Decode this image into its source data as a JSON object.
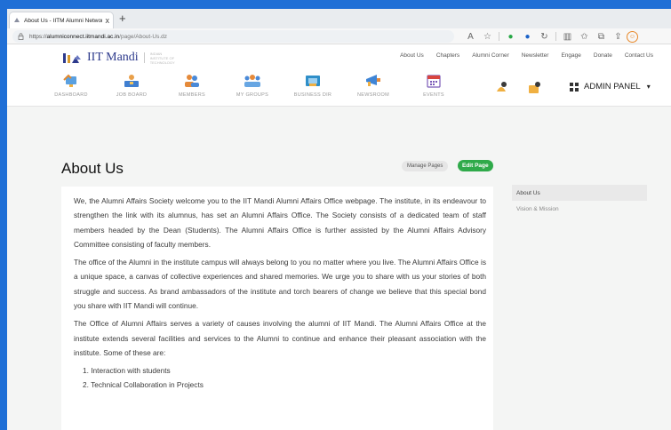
{
  "browser": {
    "tab_title": "About Us - IITM Alumni Network",
    "tab_close": "x",
    "new_tab": "+",
    "url_scheme": "https://",
    "url_host": "alumniconnect.iitmandi.ac.in",
    "url_path": "/page/About-Us.dz",
    "icons": [
      "read-aloud-icon",
      "favorite-icon",
      "extension-green-icon",
      "extension-blue-icon",
      "refresh-icon",
      "split-screen-icon",
      "favorites-icon",
      "collections-icon",
      "share-icon",
      "profile-icon"
    ]
  },
  "site": {
    "brand": "IIT Mandi",
    "tagline": "INDIAN INSTITUTE OF TECHNOLOGY",
    "top_nav": [
      "About Us",
      "Chapters",
      "Alumni Corner",
      "Newsletter",
      "Engage",
      "Donate",
      "Contact Us"
    ],
    "icon_nav": [
      {
        "label": "DASHBOARD",
        "icon": "dashboard-icon"
      },
      {
        "label": "JOB BOARD",
        "icon": "job-board-icon"
      },
      {
        "label": "MEMBERS",
        "icon": "members-icon"
      },
      {
        "label": "MY GROUPS",
        "icon": "groups-icon"
      },
      {
        "label": "BUSINESS DIR",
        "icon": "business-dir-icon"
      },
      {
        "label": "NEWSROOM",
        "icon": "newsroom-icon"
      },
      {
        "label": "EVENTS",
        "icon": "events-icon"
      }
    ],
    "admin_panel": "ADMIN PANEL",
    "admin_caret": "▾"
  },
  "main": {
    "title": "About Us",
    "manage_pages": "Manage Pages",
    "edit_page": "Edit Page",
    "paragraphs": [
      "We, the Alumni Affairs Society welcome you to the IIT Mandi Alumni Affairs Office webpage. The institute, in its endeavour to strengthen the link with its alumnus, has set an Alumni Affairs Office. The Society consists of a dedicated team of staff members headed by the Dean (Students). The Alumni Affairs Office is further assisted by the Alumni Affairs Advisory Committee consisting of faculty members.",
      "The office of the Alumni in the institute campus will always belong to you no matter where you live. The Alumni Affairs Office is a unique space, a canvas of collective experiences and shared memories. We urge you to share with us your stories of both struggle and success. As brand ambassadors of the institute and torch bearers of change we believe that this special bond you share with IIT Mandi will continue.",
      "The Office of Alumni Affairs serves a variety of causes involving the alumni of IIT Mandi. The Alumni Affairs Office at the institute extends several facilities and services to the Alumni to continue and enhance their pleasant association with the institute. Some of these are:"
    ],
    "list": [
      "1. Interaction with students",
      "2. Technical Collaboration in Projects"
    ]
  },
  "sidebar": {
    "items": [
      "About Us",
      "Vision & Mission"
    ]
  }
}
